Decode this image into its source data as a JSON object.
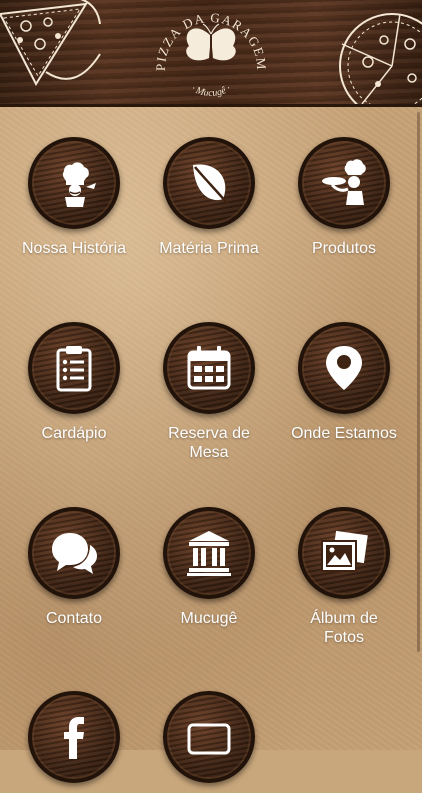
{
  "header": {
    "logo_arc_text": "PIZZA DA GARAGEM",
    "logo_sub_text": "· Mucugê ·"
  },
  "menu": [
    {
      "label": "Nossa História"
    },
    {
      "label": "Matéria Prima"
    },
    {
      "label": "Produtos"
    },
    {
      "label": "Cardápio"
    },
    {
      "label": "Reserva de Mesa"
    },
    {
      "label": "Onde Estamos"
    },
    {
      "label": "Contato"
    },
    {
      "label": "Mucugê"
    },
    {
      "label": "Álbum de Fotos"
    },
    {
      "label": ""
    },
    {
      "label": ""
    }
  ]
}
